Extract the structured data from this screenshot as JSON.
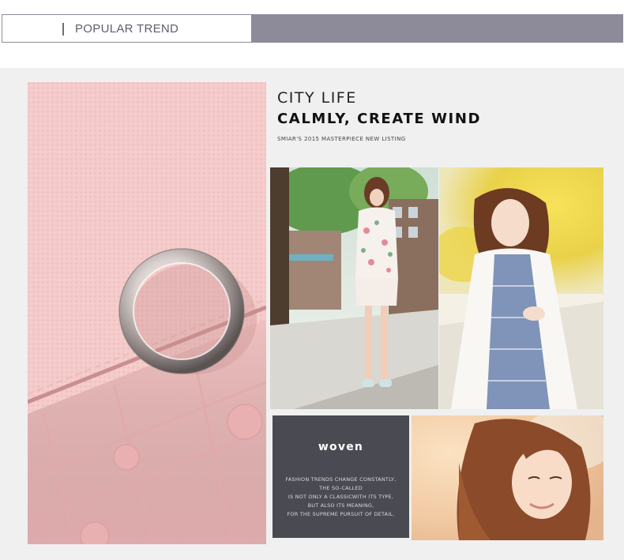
{
  "header": {
    "title": "POPULAR TREND",
    "accent_color": "#8d8b99"
  },
  "headline": {
    "line1": "CITY LIFE",
    "line2": "CALMLY, CREATE WIND",
    "subtitle": "SMIAR'S 2015 MASTERPIECE NEW LISTING"
  },
  "woven": {
    "title": "woven",
    "lines": [
      "FASHION TRENDS CHANGE CONSTANTLY,",
      "THE SO-CALLED",
      "IS NOT ONLY A CLASSICWITH ITS TYPE,",
      "BUT ALSO ITS MEANING,",
      "FOR THE SUPREME PURSUIT OF DETAIL."
    ],
    "bg_color": "#4a4a52"
  },
  "images": {
    "leather": "pink-leather-wallet-closeup",
    "street": "woman-floral-outfit-street",
    "yellow": "woman-white-cardigan-yellow-flowers",
    "portrait": "woman-smiling-portrait"
  }
}
